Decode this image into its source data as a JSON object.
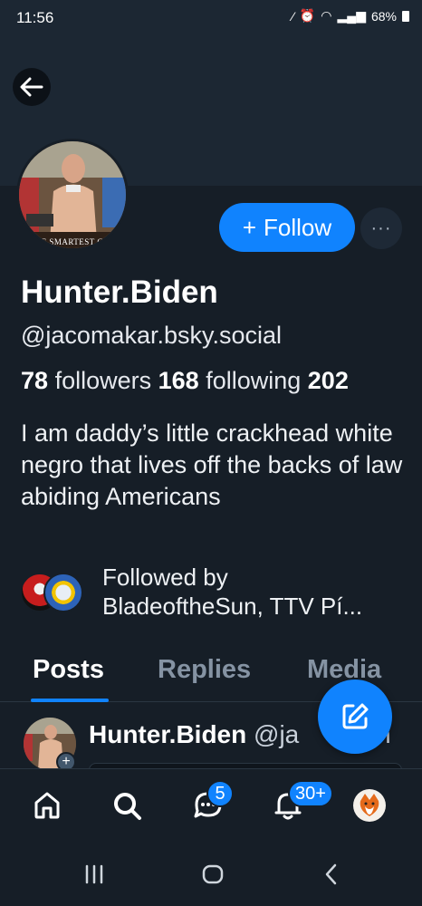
{
  "status_bar": {
    "time": "11:56",
    "battery": "68%"
  },
  "profile": {
    "avatar_caption": "E SMARTEST G",
    "display_name": "Hunter.Biden",
    "handle": "@jacomakar.bsky.social",
    "followers_count": "78",
    "followers_label": "followers",
    "following_count": "168",
    "following_label": "following",
    "posts_count": "202",
    "bio": "I am daddy’s little crackhead white negro that lives off the backs of law abiding Americans",
    "followed_by_line1": "Followed by",
    "followed_by_line2": "BladeoftheSun, TTV Pí..."
  },
  "actions": {
    "follow_label": "Follow",
    "more_label": "···"
  },
  "tabs": [
    {
      "label": "Posts",
      "active": true
    },
    {
      "label": "Replies",
      "active": false
    },
    {
      "label": "Media",
      "active": false
    }
  ],
  "post": {
    "author": "Hunter.Biden",
    "handle_partial": "@ja",
    "handle_tail": "h"
  },
  "bottom_nav": {
    "items": [
      "home-icon",
      "search-icon",
      "chat-icon",
      "notifications-icon",
      "profile-avatar"
    ],
    "chat_badge": "5",
    "notifications_badge": "30+"
  },
  "colors": {
    "accent": "#1083fe",
    "background": "#161e27",
    "banner": "#1c2733"
  }
}
